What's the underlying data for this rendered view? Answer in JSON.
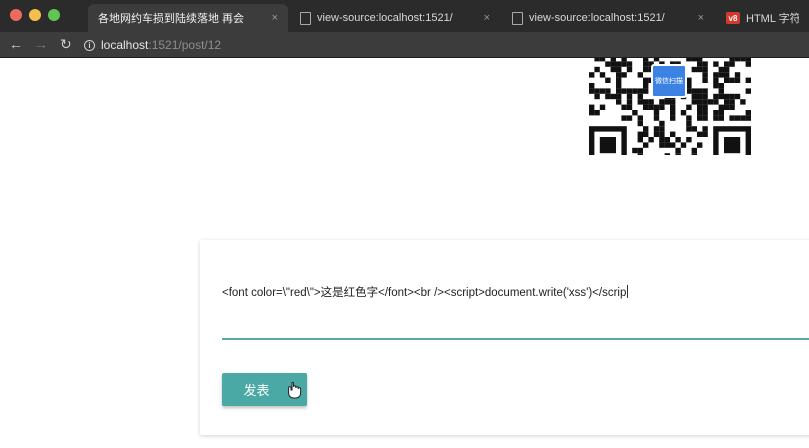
{
  "browser": {
    "tabs": [
      {
        "title": "各地网约车损到陆续落地 再会",
        "close": "×",
        "active": true
      },
      {
        "title": "view-source:localhost:1521/",
        "close": "×",
        "active": false
      },
      {
        "title": "view-source:localhost:1521/",
        "close": "×",
        "active": false
      },
      {
        "title": "HTML 字符实",
        "favicon_text": "v8",
        "active": false
      }
    ],
    "nav": {
      "back": "←",
      "forward": "→",
      "reload": "↻"
    },
    "url": {
      "host": "localhost",
      "rest": ":1521/post/12"
    }
  },
  "qr": {
    "badge_text": "微信扫描"
  },
  "editor": {
    "content": "<font color=\\\"red\\\">这是红色字</font><br /><script>document.write('xss')</scrip",
    "submit_label": "发表"
  },
  "colors": {
    "accent": "#4aa9a4",
    "underline": "#5ca5aa",
    "tabbar": "#2b2b2b",
    "toolbar": "#3c3c3c"
  }
}
